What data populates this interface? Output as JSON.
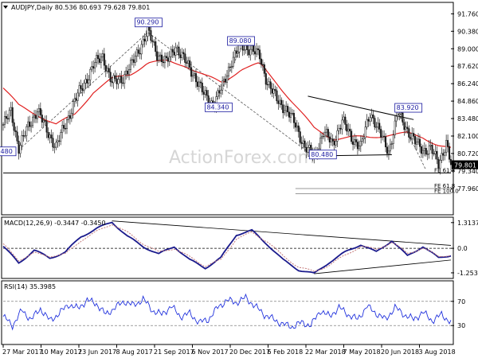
{
  "chart_data": [
    {
      "type": "candlestick",
      "title": "AUDJPY,Daily  80.536 80.693 79.628 79.801",
      "ylim": [
        76.0,
        92.6
      ],
      "y_ticks": [
        "91.760",
        "90.380",
        "89.000",
        "87.620",
        "86.240",
        "84.860",
        "83.480",
        "82.100",
        "80.720",
        "79.340",
        "77.960"
      ],
      "y_tick_values": [
        91.76,
        90.38,
        89.0,
        87.62,
        86.24,
        84.86,
        83.48,
        82.1,
        80.72,
        79.34,
        77.96
      ],
      "last_price": "79.801",
      "last_price_value": 79.801,
      "x_labels": [
        "27 Mar 2017",
        "10 May 2017",
        "23 Jun 2017",
        "8 Aug 2017",
        "21 Sep 2017",
        "6 Nov 2017",
        "20 Dec 2017",
        "6 Feb 2018",
        "22 Mar 2018",
        "7 May 2018",
        "20 Jun 2018",
        "3 Aug 2018"
      ],
      "close_path": [
        [
          0,
          83.0
        ],
        [
          5,
          84.0
        ],
        [
          10,
          81.2
        ],
        [
          16,
          82.8
        ],
        [
          22,
          84.2
        ],
        [
          28,
          82.5
        ],
        [
          34,
          81.3
        ],
        [
          40,
          83.0
        ],
        [
          46,
          84.9
        ],
        [
          52,
          86.2
        ],
        [
          58,
          87.7
        ],
        [
          64,
          88.4
        ],
        [
          70,
          86.3
        ],
        [
          76,
          86.6
        ],
        [
          82,
          87.6
        ],
        [
          88,
          89.1
        ],
        [
          93,
          90.4
        ],
        [
          99,
          88.6
        ],
        [
          105,
          87.9
        ],
        [
          111,
          89.2
        ],
        [
          117,
          88.0
        ],
        [
          123,
          86.9
        ],
        [
          129,
          85.4
        ],
        [
          135,
          84.6
        ],
        [
          141,
          86.0
        ],
        [
          147,
          88.1
        ],
        [
          153,
          89.2
        ],
        [
          159,
          89.0
        ],
        [
          165,
          88.4
        ],
        [
          170,
          86.3
        ],
        [
          176,
          85.0
        ],
        [
          182,
          84.2
        ],
        [
          188,
          83.0
        ],
        [
          194,
          81.2
        ],
        [
          200,
          80.5
        ],
        [
          206,
          82.4
        ],
        [
          212,
          81.5
        ],
        [
          218,
          83.3
        ],
        [
          224,
          82.0
        ],
        [
          230,
          81.2
        ],
        [
          236,
          84.0
        ],
        [
          242,
          82.4
        ],
        [
          248,
          80.9
        ],
        [
          254,
          83.9
        ],
        [
          260,
          82.6
        ],
        [
          265,
          81.6
        ],
        [
          270,
          81.0
        ],
        [
          275,
          81.1
        ],
        [
          280,
          79.9
        ],
        [
          285,
          81.6
        ],
        [
          288,
          79.8
        ]
      ],
      "sma": {
        "name": "SMA",
        "values": [
          [
            0,
            85.9
          ],
          [
            10,
            84.5
          ],
          [
            22,
            83.8
          ],
          [
            34,
            83.0
          ],
          [
            46,
            83.8
          ],
          [
            58,
            85.6
          ],
          [
            70,
            86.6
          ],
          [
            82,
            87.0
          ],
          [
            93,
            87.9
          ],
          [
            105,
            88.0
          ],
          [
            117,
            87.7
          ],
          [
            129,
            86.9
          ],
          [
            141,
            86.3
          ],
          [
            153,
            87.4
          ],
          [
            165,
            87.8
          ],
          [
            176,
            86.3
          ],
          [
            188,
            84.5
          ],
          [
            200,
            82.7
          ],
          [
            212,
            81.9
          ],
          [
            224,
            82.0
          ],
          [
            236,
            82.0
          ],
          [
            248,
            82.2
          ],
          [
            260,
            82.3
          ],
          [
            270,
            82.0
          ],
          [
            280,
            81.4
          ],
          [
            288,
            81.1
          ]
        ]
      },
      "annotations": [
        {
          "label": "90.290",
          "x": 93,
          "y": 90.29
        },
        {
          "label": "89.080",
          "x": 153,
          "y": 89.08
        },
        {
          "label": "84.340",
          "x": 135,
          "y": 84.34
        },
        {
          "label": "80.480",
          "x": 200,
          "y": 80.48
        },
        {
          "label": "83.920",
          "x": 254,
          "y": 83.92
        },
        {
          "label": ".480",
          "x": 0,
          "y": 80.48
        }
      ],
      "fe_levels": [
        {
          "label": "FE 61.8",
          "value": 79.18
        },
        {
          "label": "FE 61.8",
          "value": 77.95
        },
        {
          "label": "FE 100.0",
          "value": 77.55
        }
      ],
      "watermark": "ActionForex.com"
    },
    {
      "type": "line",
      "title": "MACD(12,26,9) -0.3447 -0.3450",
      "ylim": [
        -1.5,
        1.55
      ],
      "y_ticks": [
        "1.3137",
        "0.0",
        "-1.2539"
      ],
      "y_tick_values": [
        1.3137,
        0.0,
        -1.2539
      ],
      "series": [
        {
          "name": "MACD",
          "color": "#1a1a8c",
          "values": [
            [
              0,
              0.1
            ],
            [
              10,
              -0.75
            ],
            [
              20,
              -0.1
            ],
            [
              30,
              -0.5
            ],
            [
              40,
              -0.2
            ],
            [
              50,
              0.6
            ],
            [
              60,
              1.0
            ],
            [
              70,
              1.35
            ],
            [
              80,
              0.6
            ],
            [
              90,
              0.1
            ],
            [
              100,
              -0.3
            ],
            [
              110,
              0.1
            ],
            [
              120,
              -0.6
            ],
            [
              130,
              -1.0
            ],
            [
              140,
              -0.5
            ],
            [
              150,
              0.7
            ],
            [
              160,
              0.9
            ],
            [
              170,
              0.2
            ],
            [
              180,
              -0.6
            ],
            [
              190,
              -1.1
            ],
            [
              200,
              -1.3
            ],
            [
              210,
              -0.7
            ],
            [
              220,
              -0.2
            ],
            [
              230,
              0.2
            ],
            [
              240,
              -0.2
            ],
            [
              250,
              0.4
            ],
            [
              260,
              -0.4
            ],
            [
              270,
              0.1
            ],
            [
              280,
              -0.5
            ],
            [
              288,
              -0.3447
            ]
          ]
        },
        {
          "name": "Signal",
          "color": "#c47a7a",
          "values": [
            [
              0,
              0.2
            ],
            [
              10,
              -0.6
            ],
            [
              20,
              -0.25
            ],
            [
              30,
              -0.4
            ],
            [
              40,
              -0.3
            ],
            [
              50,
              0.4
            ],
            [
              60,
              0.85
            ],
            [
              70,
              1.25
            ],
            [
              80,
              0.8
            ],
            [
              90,
              0.25
            ],
            [
              100,
              -0.2
            ],
            [
              110,
              0.0
            ],
            [
              120,
              -0.45
            ],
            [
              130,
              -0.9
            ],
            [
              140,
              -0.6
            ],
            [
              150,
              0.5
            ],
            [
              160,
              0.8
            ],
            [
              170,
              0.35
            ],
            [
              180,
              -0.4
            ],
            [
              190,
              -0.95
            ],
            [
              200,
              -1.2
            ],
            [
              210,
              -0.85
            ],
            [
              220,
              -0.35
            ],
            [
              230,
              0.1
            ],
            [
              240,
              -0.05
            ],
            [
              250,
              0.3
            ],
            [
              260,
              -0.25
            ],
            [
              270,
              0.0
            ],
            [
              280,
              -0.4
            ],
            [
              288,
              -0.345
            ]
          ]
        }
      ]
    },
    {
      "type": "line",
      "title": "RSI(14) 35.3985",
      "ylim": [
        0,
        100
      ],
      "y_ticks": [
        "70",
        "30"
      ],
      "y_tick_values": [
        70,
        30
      ],
      "series": [
        {
          "name": "RSI",
          "color": "#2233dd",
          "values": [
            [
              0,
              45
            ],
            [
              6,
              30
            ],
            [
              12,
              55
            ],
            [
              18,
              40
            ],
            [
              24,
              58
            ],
            [
              30,
              38
            ],
            [
              36,
              50
            ],
            [
              42,
              65
            ],
            [
              48,
              58
            ],
            [
              54,
              72
            ],
            [
              60,
              66
            ],
            [
              66,
              48
            ],
            [
              72,
              60
            ],
            [
              78,
              70
            ],
            [
              84,
              63
            ],
            [
              90,
              74
            ],
            [
              96,
              55
            ],
            [
              102,
              48
            ],
            [
              108,
              62
            ],
            [
              114,
              45
            ],
            [
              120,
              50
            ],
            [
              126,
              35
            ],
            [
              132,
              40
            ],
            [
              138,
              60
            ],
            [
              144,
              72
            ],
            [
              150,
              68
            ],
            [
              156,
              76
            ],
            [
              162,
              62
            ],
            [
              168,
              48
            ],
            [
              174,
              40
            ],
            [
              180,
              32
            ],
            [
              186,
              28
            ],
            [
              192,
              35
            ],
            [
              198,
              30
            ],
            [
              204,
              55
            ],
            [
              210,
              45
            ],
            [
              216,
              60
            ],
            [
              222,
              48
            ],
            [
              228,
              40
            ],
            [
              234,
              62
            ],
            [
              240,
              50
            ],
            [
              246,
              40
            ],
            [
              252,
              60
            ],
            [
              258,
              48
            ],
            [
              264,
              40
            ],
            [
              270,
              52
            ],
            [
              276,
              38
            ],
            [
              282,
              48
            ],
            [
              288,
              35.4
            ]
          ]
        }
      ]
    }
  ]
}
